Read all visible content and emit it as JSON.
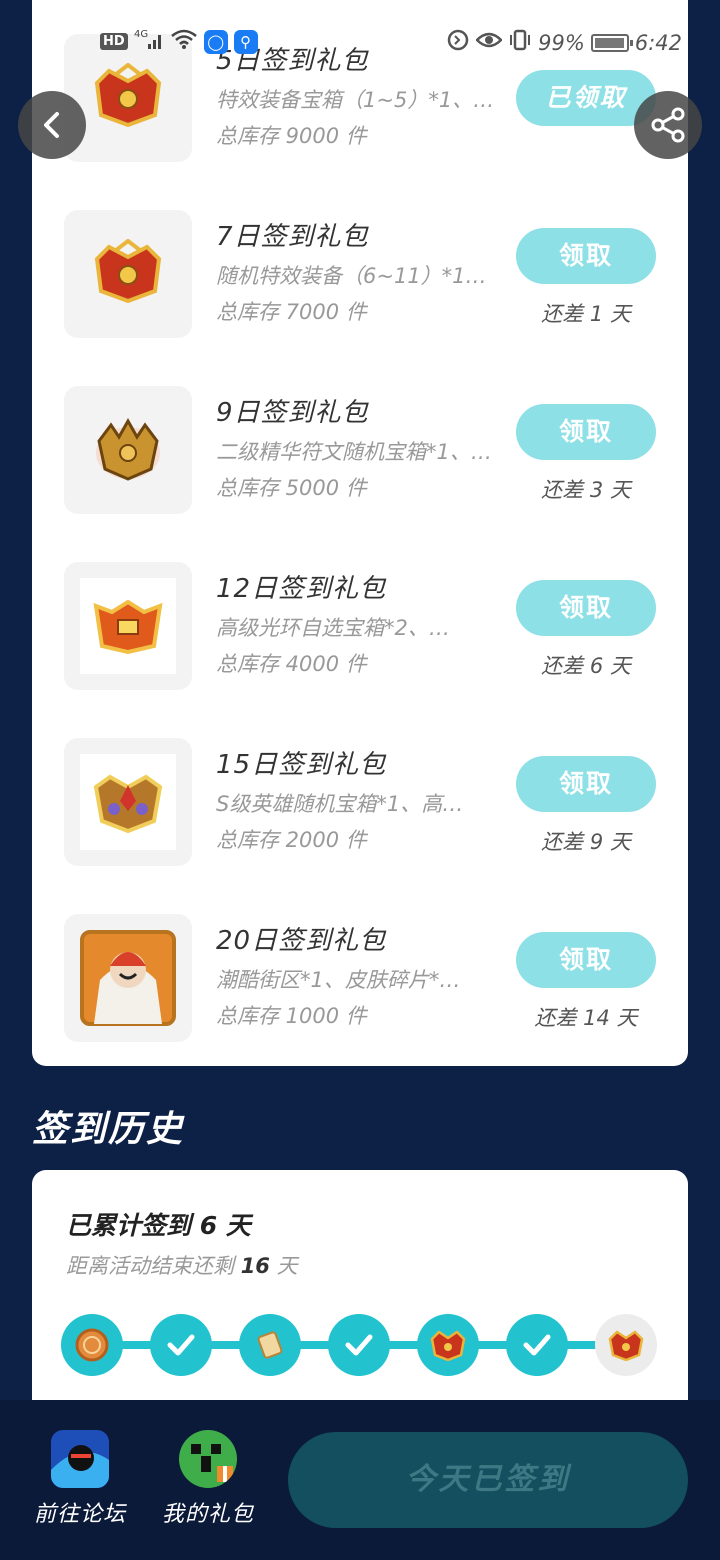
{
  "status_bar": {
    "hd_label": "HD",
    "network_label": "4G",
    "battery_percent": "99%",
    "time": "6:42"
  },
  "gifts": [
    {
      "title": "5日签到礼包",
      "desc": "特效装备宝箱（1~5）*1、…",
      "stock": "总库存 9000 件",
      "button": "已领取",
      "remain": "",
      "claimed": true,
      "icon": "chest-red-gold-icon"
    },
    {
      "title": "7日签到礼包",
      "desc": "随机特效装备（6~11）*1、…",
      "stock": "总库存 7000 件",
      "button": "领取",
      "remain": "还差 1 天",
      "claimed": false,
      "icon": "chest-red-gold-icon"
    },
    {
      "title": "9日签到礼包",
      "desc": "二级精华符文随机宝箱*1、…",
      "stock": "总库存 5000 件",
      "button": "领取",
      "remain": "还差 3 天",
      "claimed": false,
      "icon": "chest-gold-spiked-icon"
    },
    {
      "title": "12日签到礼包",
      "desc": "高级光环自选宝箱*2、…",
      "stock": "总库存 4000 件",
      "button": "领取",
      "remain": "还差 6 天",
      "claimed": false,
      "icon": "chest-orange-icon"
    },
    {
      "title": "15日签到礼包",
      "desc": "S级英雄随机宝箱*1、高…",
      "stock": "总库存 2000 件",
      "button": "领取",
      "remain": "还差 9 天",
      "claimed": false,
      "icon": "chest-gold-purple-icon"
    },
    {
      "title": "20日签到礼包",
      "desc": "潮酷街区*1、皮肤碎片*…",
      "stock": "总库存 1000 件",
      "button": "领取",
      "remain": "还差 14 天",
      "claimed": false,
      "icon": "skin-portrait-icon"
    }
  ],
  "history": {
    "heading": "签到历史",
    "title": "已累计签到 6 天",
    "sub_prefix": "距离活动结束还剩 ",
    "sub_days": "16",
    "sub_suffix": " 天",
    "nodes": [
      {
        "state": "done",
        "icon": "coin-icon"
      },
      {
        "state": "done",
        "icon": "check-icon"
      },
      {
        "state": "done",
        "icon": "scroll-icon"
      },
      {
        "state": "done",
        "icon": "check-icon"
      },
      {
        "state": "done",
        "icon": "chest-icon"
      },
      {
        "state": "done",
        "icon": "check-icon"
      },
      {
        "state": "next",
        "icon": "chest-icon"
      }
    ]
  },
  "bottom": {
    "forum_label": "前往论坛",
    "gifts_label": "我的礼包",
    "signed_label": "今天已签到"
  },
  "colors": {
    "accent": "#22c3cf",
    "button": "#8ee0e7",
    "background": "#0d2147"
  }
}
